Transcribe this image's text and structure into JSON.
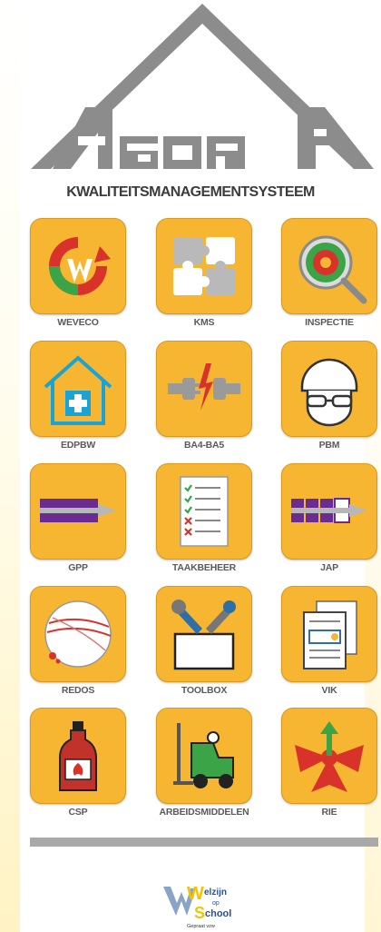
{
  "app": {
    "logo_text": "AGORA",
    "subtitle": "KWALITEITSMANAGEMENTSYSTEEM"
  },
  "colors": {
    "tile": "#f7b631",
    "tile_border": "#d89a1c",
    "text": "#5a5a5a",
    "roof": "#8c8c8c",
    "logo_red": "#d9322b",
    "brand_blue": "#2b4f98"
  },
  "tiles": [
    {
      "label": "WEVECO",
      "icon": "recycle-w-icon"
    },
    {
      "label": "KMS",
      "icon": "puzzle-icon"
    },
    {
      "label": "INSPECTIE",
      "icon": "magnifier-target-icon"
    },
    {
      "label": "EDPBW",
      "icon": "house-medical-icon"
    },
    {
      "label": "BA4-BA5",
      "icon": "electric-plug-icon"
    },
    {
      "label": "PBM",
      "icon": "helmet-goggles-icon"
    },
    {
      "label": "GPP",
      "icon": "progress-arrow-icon"
    },
    {
      "label": "TAAKBEHEER",
      "icon": "checklist-icon"
    },
    {
      "label": "JAP",
      "icon": "segmented-arrow-icon"
    },
    {
      "label": "REDOS",
      "icon": "bandaged-ball-icon"
    },
    {
      "label": "TOOLBOX",
      "icon": "tools-box-icon"
    },
    {
      "label": "VIK",
      "icon": "documents-icon"
    },
    {
      "label": "CSP",
      "icon": "chemical-bottle-icon"
    },
    {
      "label": "ARBEIDSMIDDELEN",
      "icon": "forklift-icon"
    },
    {
      "label": "RIE",
      "icon": "risk-arrows-icon"
    }
  ],
  "footer": {
    "logo_line1": "elzijn",
    "logo_op": "op",
    "logo_line2": "chool",
    "logo_caption": "Gepraat vzw"
  }
}
